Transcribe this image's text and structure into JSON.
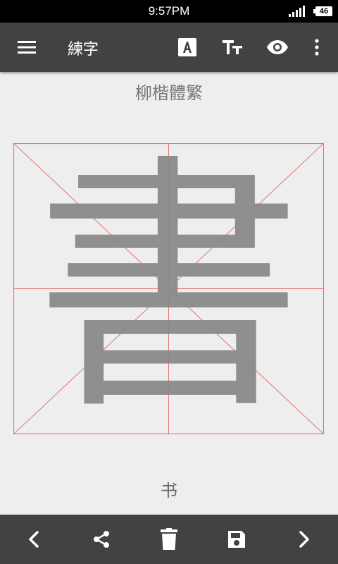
{
  "status": {
    "time": "9:57PM",
    "battery": "46"
  },
  "toolbar": {
    "title": "練字",
    "icons": [
      "menu-icon",
      "font-style-icon",
      "text-size-icon",
      "eye-icon",
      "more-vert-icon"
    ]
  },
  "canvas": {
    "font_name": "柳楷體繁",
    "character": "書",
    "simplified": "书",
    "grid_color": "#e57373",
    "glyph_color": "#8a8a8a"
  },
  "bottom_bar": {
    "icons": [
      "chevron-left-icon",
      "share-icon",
      "delete-icon",
      "save-icon",
      "chevron-right-icon"
    ]
  },
  "colors": {
    "toolbar": "#424242",
    "status_bar": "#000000",
    "background": "#eeeeee"
  }
}
